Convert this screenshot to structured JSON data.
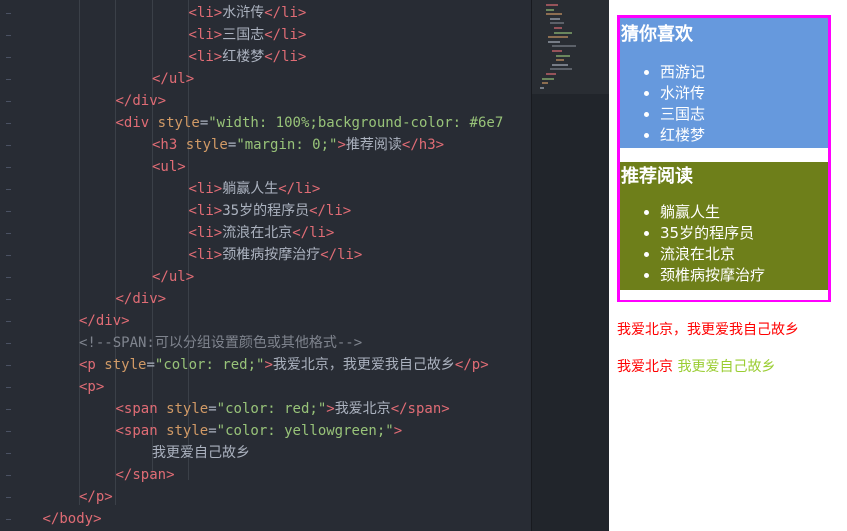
{
  "editor": {
    "lines": [
      {
        "indent": 5,
        "tokens": [
          [
            "tag",
            "<li>"
          ],
          [
            "text",
            "水浒传"
          ],
          [
            "tag",
            "</li>"
          ]
        ]
      },
      {
        "indent": 5,
        "tokens": [
          [
            "tag",
            "<li>"
          ],
          [
            "text",
            "三国志"
          ],
          [
            "tag",
            "</li>"
          ]
        ]
      },
      {
        "indent": 5,
        "tokens": [
          [
            "tag",
            "<li>"
          ],
          [
            "text",
            "红楼梦"
          ],
          [
            "tag",
            "</li>"
          ]
        ]
      },
      {
        "indent": 4,
        "tokens": [
          [
            "tag",
            "</ul>"
          ]
        ]
      },
      {
        "indent": 3,
        "tokens": [
          [
            "tag",
            "</div>"
          ]
        ]
      },
      {
        "indent": 3,
        "tokens": [
          [
            "tag",
            "<div "
          ],
          [
            "attr",
            "style"
          ],
          [
            "punct",
            "="
          ],
          [
            "str",
            "\"width: 100%;background-color: #6e7"
          ]
        ]
      },
      {
        "indent": 4,
        "tokens": [
          [
            "tag",
            "<h3 "
          ],
          [
            "attr",
            "style"
          ],
          [
            "punct",
            "="
          ],
          [
            "str",
            "\"margin: 0;\""
          ],
          [
            "tag",
            ">"
          ],
          [
            "text",
            "推荐阅读"
          ],
          [
            "tag",
            "</h3>"
          ]
        ]
      },
      {
        "indent": 4,
        "tokens": [
          [
            "tag",
            "<ul>"
          ]
        ]
      },
      {
        "indent": 5,
        "tokens": [
          [
            "tag",
            "<li>"
          ],
          [
            "text",
            "躺赢人生"
          ],
          [
            "tag",
            "</li>"
          ]
        ]
      },
      {
        "indent": 5,
        "tokens": [
          [
            "tag",
            "<li>"
          ],
          [
            "text",
            "35岁的程序员"
          ],
          [
            "tag",
            "</li>"
          ]
        ]
      },
      {
        "indent": 5,
        "tokens": [
          [
            "tag",
            "<li>"
          ],
          [
            "text",
            "流浪在北京"
          ],
          [
            "tag",
            "</li>"
          ]
        ]
      },
      {
        "indent": 5,
        "tokens": [
          [
            "tag",
            "<li>"
          ],
          [
            "text",
            "颈椎病按摩治疗"
          ],
          [
            "tag",
            "</li>"
          ]
        ]
      },
      {
        "indent": 4,
        "tokens": [
          [
            "tag",
            "</ul>"
          ]
        ]
      },
      {
        "indent": 3,
        "tokens": [
          [
            "tag",
            "</div>"
          ]
        ]
      },
      {
        "indent": 2,
        "tokens": [
          [
            "tag",
            "</div>"
          ]
        ]
      },
      {
        "indent": 2,
        "tokens": [
          [
            "comment",
            "<!--SPAN:可以分组设置颜色或其他格式-->"
          ]
        ]
      },
      {
        "indent": 2,
        "tokens": [
          [
            "tag",
            "<p "
          ],
          [
            "attr",
            "style"
          ],
          [
            "punct",
            "="
          ],
          [
            "str",
            "\"color: red;\""
          ],
          [
            "tag",
            ">"
          ],
          [
            "text",
            "我爱北京，我更爱我自己故乡"
          ],
          [
            "tag",
            "</p>"
          ]
        ]
      },
      {
        "indent": 2,
        "tokens": [
          [
            "tag",
            "<p>"
          ]
        ]
      },
      {
        "indent": 3,
        "tokens": [
          [
            "tag",
            "<span "
          ],
          [
            "attr",
            "style"
          ],
          [
            "punct",
            "="
          ],
          [
            "str",
            "\"color: red;\""
          ],
          [
            "tag",
            ">"
          ],
          [
            "text",
            "我爱北京"
          ],
          [
            "tag",
            "</span>"
          ]
        ]
      },
      {
        "indent": 3,
        "tokens": [
          [
            "tag",
            "<span "
          ],
          [
            "attr",
            "style"
          ],
          [
            "punct",
            "="
          ],
          [
            "str",
            "\"color: yellowgreen;\""
          ],
          [
            "tag",
            ">"
          ]
        ]
      },
      {
        "indent": 4,
        "tokens": [
          [
            "text",
            "我更爱自己故乡"
          ]
        ]
      },
      {
        "indent": 3,
        "tokens": [
          [
            "tag",
            "</span>"
          ]
        ]
      },
      {
        "indent": 2,
        "tokens": [
          [
            "tag",
            "</p>"
          ]
        ]
      },
      {
        "indent": 1,
        "tokens": [
          [
            "tag",
            "</body>"
          ]
        ]
      }
    ]
  },
  "preview": {
    "block1": {
      "heading": "猜你喜欢",
      "items": [
        "西游记",
        "水浒传",
        "三国志",
        "红楼梦"
      ]
    },
    "block2": {
      "heading": "推荐阅读",
      "items": [
        "躺赢人生",
        "35岁的程序员",
        "流浪在北京",
        "颈椎病按摩治疗"
      ]
    },
    "p1": "我爱北京，我更爱我自己故乡",
    "p2_red": "我爱北京",
    "p2_green": "我更爱自己故乡"
  },
  "colors": {
    "block1_bg": "#6699dd",
    "block2_bg": "#6e7f1a",
    "outer_border": "#ff00ff",
    "red": "#ff0000",
    "yellowgreen": "#9acd32"
  }
}
